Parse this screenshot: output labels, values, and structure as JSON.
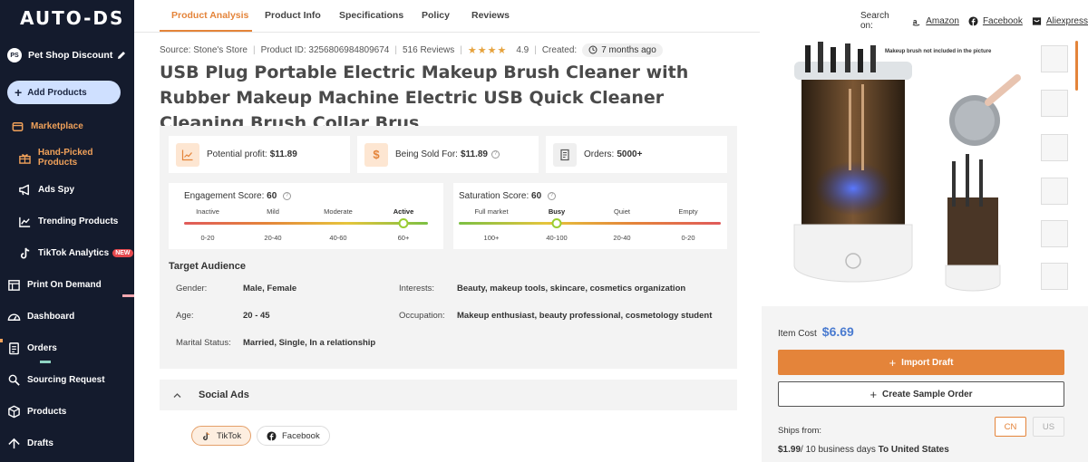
{
  "sidebar": {
    "logo": "AUTO-DS",
    "store": {
      "badge": "PS",
      "name": "Pet Shop Discount"
    },
    "add_products": "Add Products",
    "items": [
      {
        "label": "Marketplace",
        "icon": "store-icon"
      },
      {
        "label": "Hand-Picked Products",
        "icon": "gift-icon"
      },
      {
        "label": "Ads Spy",
        "icon": "megaphone-icon"
      },
      {
        "label": "Trending Products",
        "icon": "trending-icon"
      },
      {
        "label": "TikTok Analytics",
        "icon": "tiktok-icon",
        "badge": "NEW"
      },
      {
        "label": "Print On Demand",
        "icon": "print-icon"
      },
      {
        "label": "Dashboard",
        "icon": "dashboard-icon"
      },
      {
        "label": "Orders",
        "icon": "orders-icon"
      },
      {
        "label": "Sourcing Request",
        "icon": "sourcing-icon"
      },
      {
        "label": "Products",
        "icon": "box-icon"
      },
      {
        "label": "Drafts",
        "icon": "drafts-icon"
      }
    ]
  },
  "tabs": [
    "Product Analysis",
    "Product Info",
    "Specifications",
    "Policy",
    "Reviews"
  ],
  "search_on": {
    "label": "Search on:",
    "sites": [
      "Amazon",
      "Facebook",
      "Aliexpress"
    ]
  },
  "meta": {
    "source": "Source: Stone's Store",
    "product_id": "Product ID: 3256806984809674",
    "reviews": "516 Reviews",
    "stars": "★★★★",
    "rating": "4.9",
    "created_label": "Created:",
    "created_value": "7 months ago"
  },
  "title": "USB Plug Portable Electric Makeup Brush Cleaner with Rubber Makeup Machine Electric USB Quick Cleaner Cleaning Brush Collar Brus",
  "stats": {
    "profit_label": "Potential profit:",
    "profit_value": "$11.89",
    "sold_label": "Being Sold For:",
    "sold_value": "$11.89",
    "orders_label": "Orders:",
    "orders_value": "5000+",
    "dollar_glyph": "$"
  },
  "engagement": {
    "label": "Engagement Score:",
    "value": "60",
    "levels": [
      "Inactive",
      "Mild",
      "Moderate",
      "Active"
    ],
    "ranges": [
      "0-20",
      "20-40",
      "40-60",
      "60+"
    ],
    "selected_index": 3
  },
  "saturation": {
    "label": "Saturation Score:",
    "value": "60",
    "levels": [
      "Full market",
      "Busy",
      "Quiet",
      "Empty"
    ],
    "ranges": [
      "100+",
      "40-100",
      "20-40",
      "0-20"
    ],
    "selected_index": 1
  },
  "audience": {
    "title": "Target Audience",
    "gender_label": "Gender:",
    "gender": "Male, Female",
    "age_label": "Age:",
    "age": "20 - 45",
    "marital_label": "Marital Status:",
    "marital": "Married, Single, In a relationship",
    "interests_label": "Interests:",
    "interests": "Beauty, makeup tools, skincare, cosmetics organization",
    "occupation_label": "Occupation:",
    "occupation": "Makeup enthusiast, beauty professional, cosmetology student"
  },
  "social": {
    "title": "Social Ads",
    "chips": [
      "TikTok",
      "Facebook"
    ]
  },
  "image": {
    "caption": "Makeup brush not included in the picture"
  },
  "purchase": {
    "item_cost_label": "Item Cost",
    "item_cost": "$6.69",
    "import_label": "Import Draft",
    "sample_label": "Create Sample Order",
    "ships_from_label": "Ships from:",
    "ship_cn": "CN",
    "ship_us": "US",
    "shipping_price": "$1.99",
    "shipping_days": "/ 10 business days",
    "shipping_dest": "To United States"
  },
  "colors": {
    "sidebar_bg": "#141b2d",
    "accent": "#e4843a",
    "price_blue": "#4a7bd0"
  }
}
